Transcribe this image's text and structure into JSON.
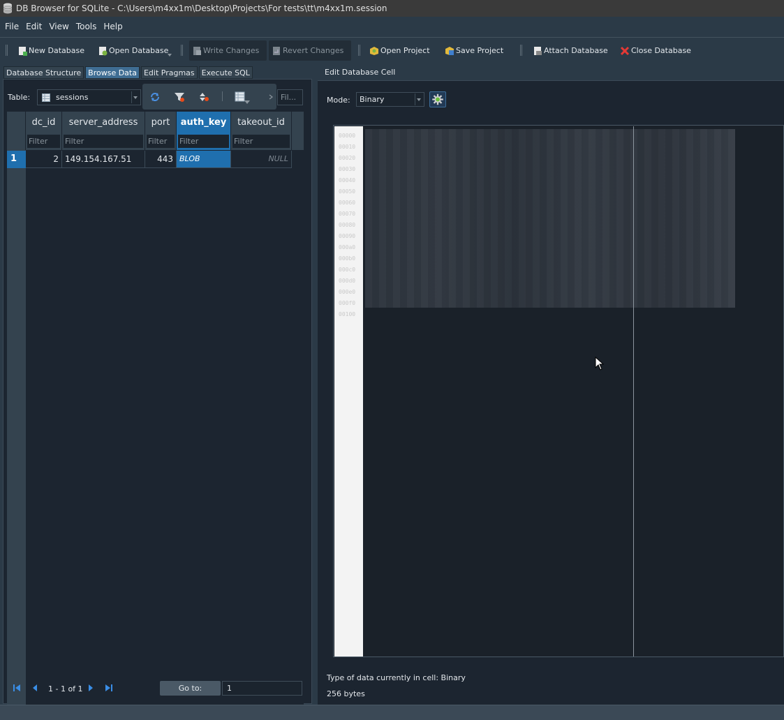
{
  "window": {
    "title": "DB Browser for SQLite - C:\\Users\\m4xx1m\\Desktop\\Projects\\For tests\\tt\\m4xx1m.session"
  },
  "menu": [
    "File",
    "Edit",
    "View",
    "Tools",
    "Help"
  ],
  "toolbar": {
    "new_database": "New Database",
    "open_database": "Open Database",
    "write_changes": "Write Changes",
    "revert_changes": "Revert Changes",
    "open_project": "Open Project",
    "save_project": "Save Project",
    "attach_database": "Attach Database",
    "close_database": "Close Database"
  },
  "tabs": [
    "Database Structure",
    "Browse Data",
    "Edit Pragmas",
    "Execute SQL"
  ],
  "browse": {
    "table_label": "Table:",
    "table_value": "sessions",
    "filter_placeholder": "Fil...",
    "columns": [
      "dc_id",
      "server_address",
      "port",
      "auth_key",
      "takeout_id"
    ],
    "column_filter": "Filter",
    "rows": [
      {
        "num": "1",
        "dc_id": "2",
        "server_address": "149.154.167.51",
        "port": "443",
        "auth_key": "BLOB",
        "takeout_id": "NULL"
      }
    ],
    "nav": {
      "page_info": "1 - 1 of 1",
      "goto_label": "Go to:",
      "goto_value": "1"
    }
  },
  "edit_cell": {
    "header": "Edit Database Cell",
    "mode_label": "Mode:",
    "mode_value": "Binary",
    "type_info": "Type of data currently in cell: Binary",
    "size_info": "256 bytes"
  },
  "colors": {
    "accent": "#1f6fae",
    "background": "#2b3a47",
    "panel": "#1c2530"
  }
}
